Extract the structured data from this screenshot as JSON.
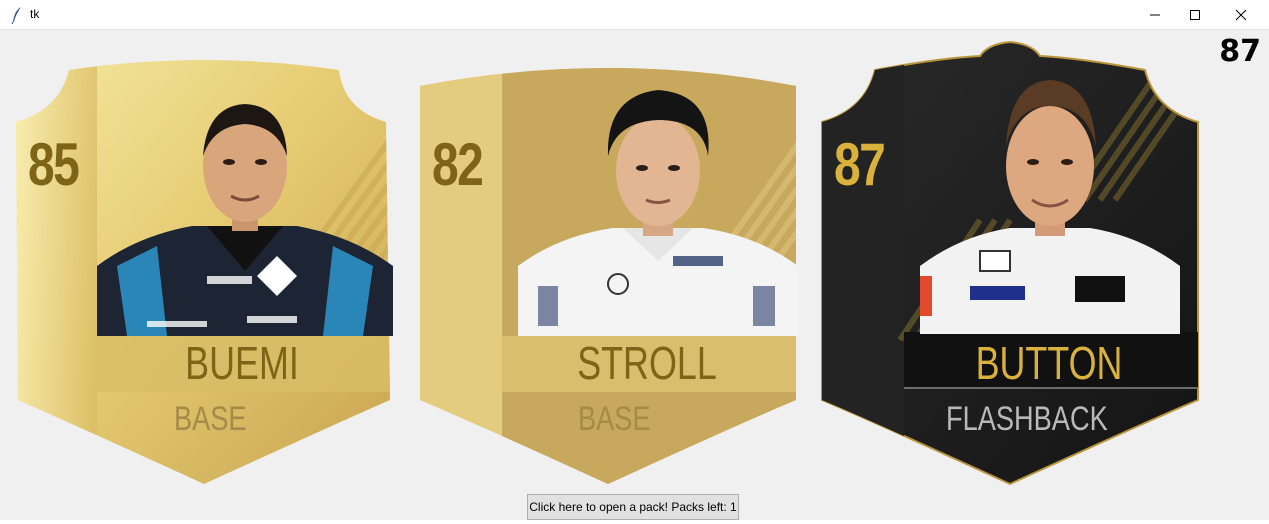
{
  "window": {
    "title": "tk"
  },
  "top_rating": "87",
  "cards": [
    {
      "rating": "85",
      "name": "BUEMI",
      "type": "BASE"
    },
    {
      "rating": "82",
      "name": "STROLL",
      "type": "BASE"
    },
    {
      "rating": "87",
      "name": "BUTTON",
      "type": "FLASHBACK"
    }
  ],
  "open_pack_button": {
    "label": "Click here to open a pack! Packs left: 1"
  },
  "colors": {
    "gold_light": "#f3e08f",
    "gold_mid": "#e0c26a",
    "gold_dark": "#c7a24d",
    "gold_text_dark": "#7d6416",
    "gold_text_mute": "#a48b48",
    "black_card": "#1e1e1e",
    "black_gold_text": "#d9b13b",
    "flashback_text": "#b9b9b9"
  }
}
